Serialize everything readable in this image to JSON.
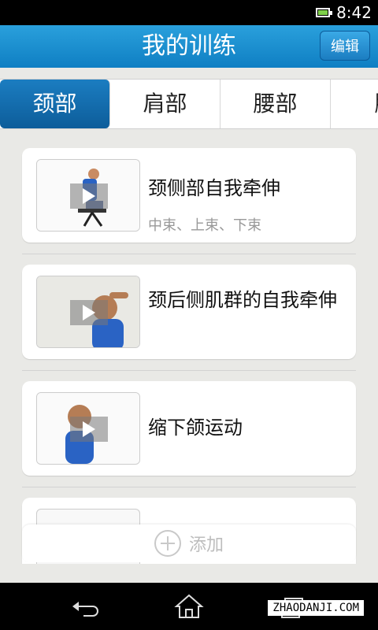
{
  "status": {
    "time": "8:42"
  },
  "header": {
    "title": "我的训练",
    "edit_label": "编辑"
  },
  "tabs": [
    {
      "label": "颈部",
      "active": true
    },
    {
      "label": "肩部"
    },
    {
      "label": "腰部"
    },
    {
      "label": "腕"
    }
  ],
  "exercises": [
    {
      "title": "颈侧部自我牵伸",
      "subtitle": "中束、上束、下束"
    },
    {
      "title": "颈后侧肌群的自我牵伸",
      "subtitle": ""
    },
    {
      "title": "缩下颌运动",
      "subtitle": ""
    },
    {
      "title": "",
      "subtitle": ""
    }
  ],
  "add_button": {
    "label": "添加"
  },
  "watermark": {
    "text": "ZHAODANJI.COM"
  },
  "colors": {
    "accent": "#1b7dc1",
    "header": "#2aa0dc"
  }
}
